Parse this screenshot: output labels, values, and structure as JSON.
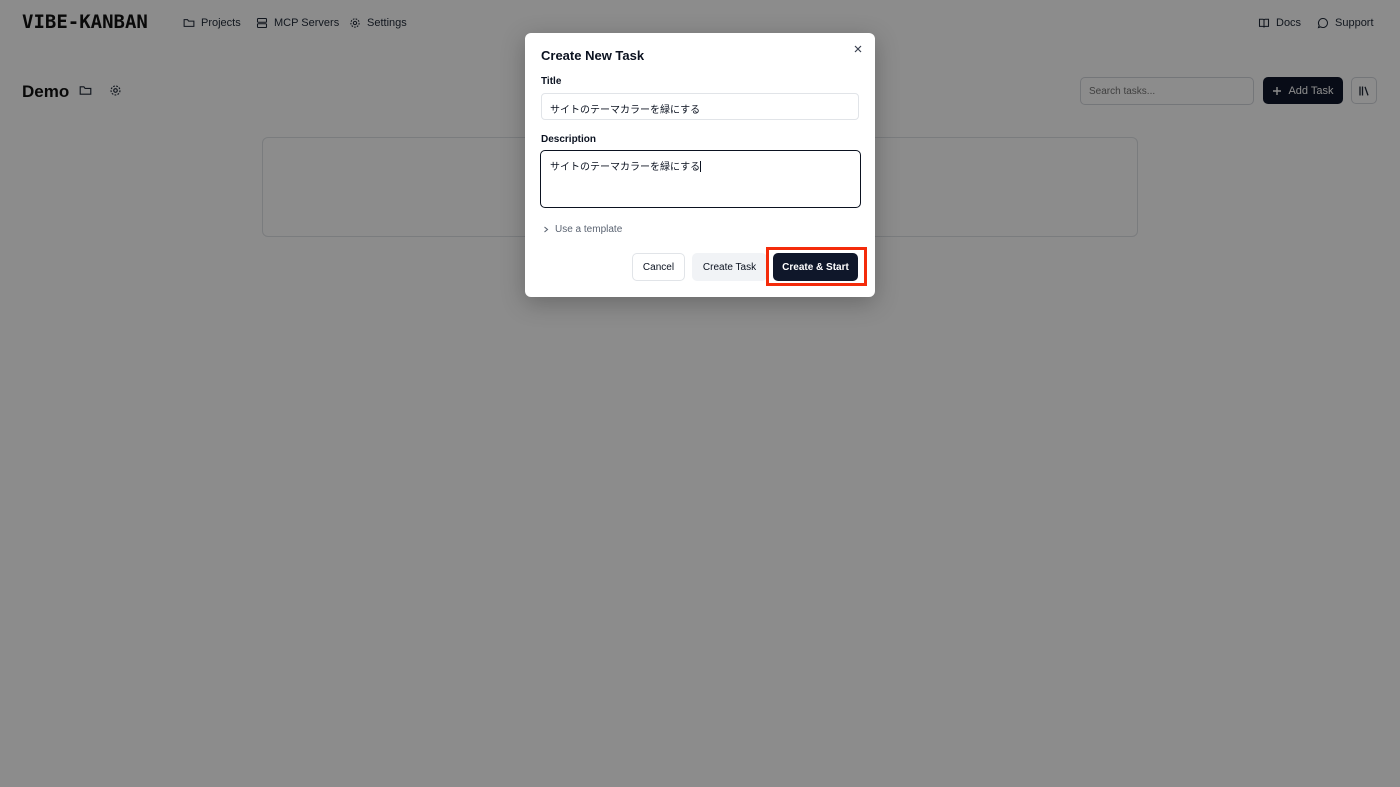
{
  "nav": {
    "logo": "VIBE-KANBAN",
    "projects": "Projects",
    "mcp_servers": "MCP Servers",
    "settings": "Settings",
    "docs": "Docs",
    "support": "Support"
  },
  "project": {
    "name": "Demo",
    "search_placeholder": "Search tasks...",
    "add_task": "Add Task"
  },
  "dialog": {
    "title": "Create New Task",
    "title_label": "Title",
    "title_value": "サイトのテーマカラーを緑にする",
    "description_label": "Description",
    "description_value": "サイトのテーマカラーを緑にする",
    "template_toggle": "Use a template",
    "cancel": "Cancel",
    "create_task": "Create Task",
    "create_and_start": "Create & Start"
  },
  "colors": {
    "primary": "#0f172a",
    "highlight": "#f42b0a",
    "overlay": "rgba(0,0,0,0.45)"
  }
}
